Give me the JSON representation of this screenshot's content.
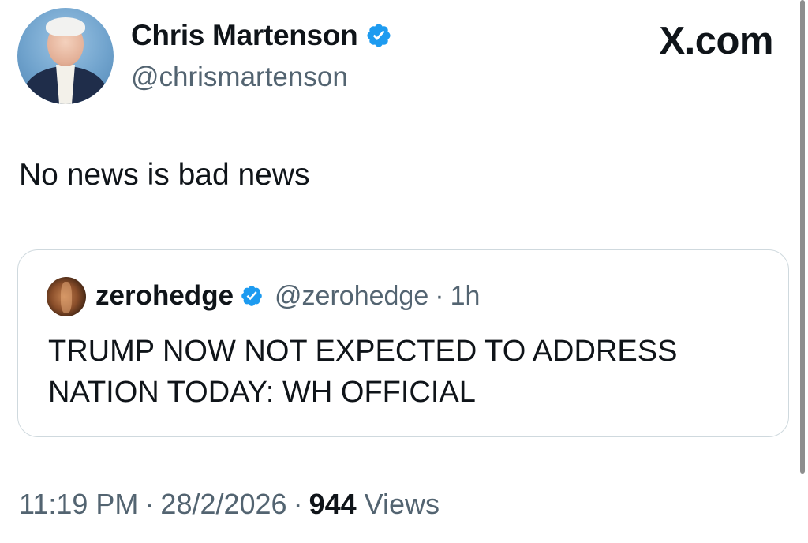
{
  "author": {
    "display_name": "Chris Martenson",
    "handle": "@chrismartenson",
    "verified_icon": "verified-badge-icon"
  },
  "brand": "X.com",
  "tweet_text": "No news is bad news",
  "quoted": {
    "display_name": "zerohedge",
    "handle": "@zerohedge",
    "separator": "·",
    "time": "1h",
    "line1": "TRUMP NOW NOT EXPECTED TO ADDRESS",
    "line2": "NATION TODAY: WH OFFICIAL"
  },
  "meta": {
    "time": "11:19 PM",
    "separator": "·",
    "date": "28/2/2026",
    "views_count": "944",
    "views_label": "Views"
  },
  "colors": {
    "verified": "#1d9bf0",
    "text": "#0f1419",
    "secondary": "#536471",
    "border": "#cfd9de"
  }
}
